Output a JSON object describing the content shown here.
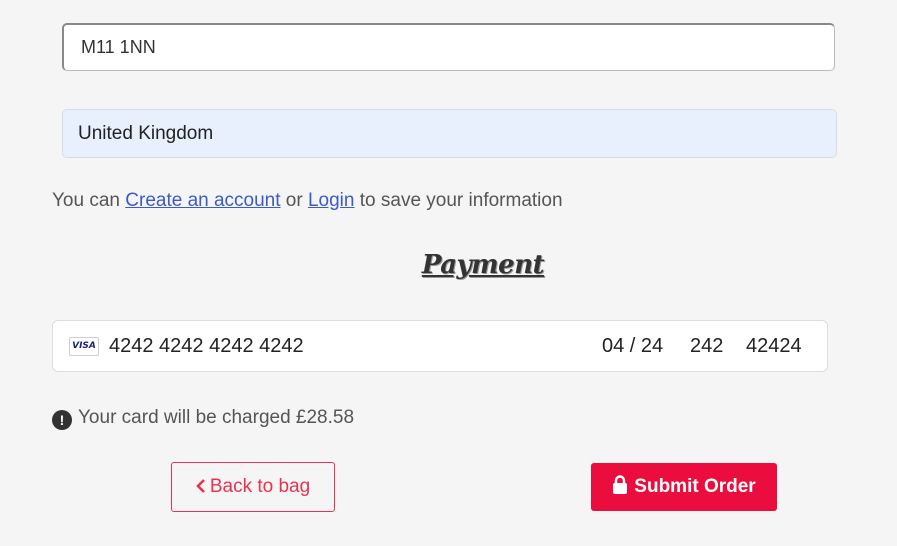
{
  "address": {
    "postcode_value": "M11 1NN",
    "country": "United Kingdom"
  },
  "account_prompt": {
    "prefix": "You can ",
    "create_link": "Create an account",
    "middle": " or ",
    "login_link": "Login",
    "suffix": " to save your information"
  },
  "payment": {
    "title": "Payment",
    "card_brand": "VISA",
    "card_number": "4242 4242 4242 4242",
    "expiry": "04 / 24",
    "cvc": "242",
    "postal": "42424"
  },
  "charge_notice": "Your card will be charged £28.58",
  "buttons": {
    "back_label": "Back to bag",
    "submit_label": "Submit Order"
  },
  "colors": {
    "accent": "#eb0d3d",
    "link": "#3b5cc6",
    "autofill_bg": "#e8f0fe"
  },
  "icons": {
    "info": "info-circle-icon",
    "back": "chevron-left-icon",
    "lock": "lock-icon",
    "card": "visa-icon"
  }
}
